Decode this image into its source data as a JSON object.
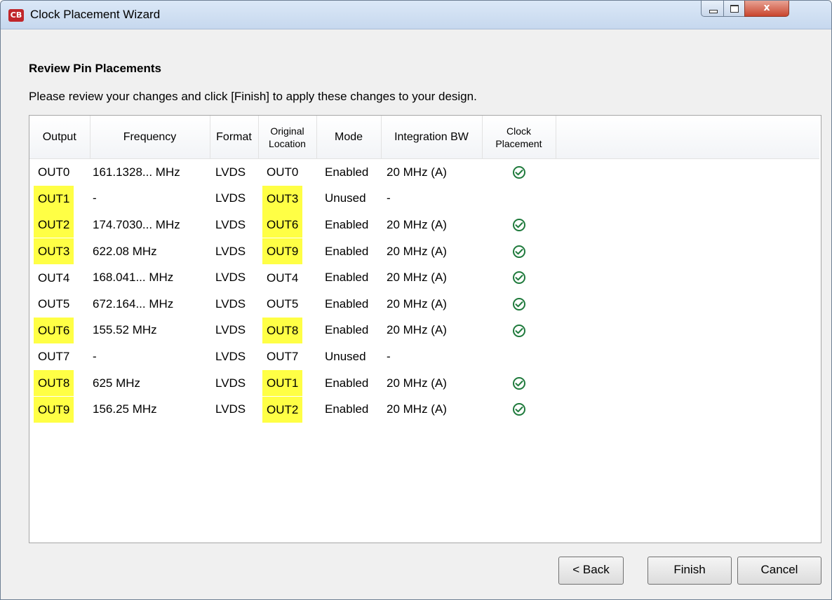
{
  "window": {
    "title": "Clock Placement Wizard",
    "app_icon_text": "CB"
  },
  "page": {
    "heading": "Review Pin Placements",
    "instructions": "Please review your changes and click [Finish] to apply these changes to your design."
  },
  "table": {
    "columns": [
      {
        "key": "output",
        "label": "Output"
      },
      {
        "key": "frequency",
        "label": "Frequency"
      },
      {
        "key": "format",
        "label": "Format"
      },
      {
        "key": "original_location",
        "label_line1": "Original",
        "label_line2": "Location"
      },
      {
        "key": "mode",
        "label": "Mode"
      },
      {
        "key": "integration_bw",
        "label": "Integration BW"
      },
      {
        "key": "clock_placement",
        "label_line1": "Clock",
        "label_line2": "Placement"
      }
    ],
    "rows": [
      {
        "output": "OUT0",
        "frequency": "161.1328... MHz",
        "format": "LVDS",
        "original_location": "OUT0",
        "mode": "Enabled",
        "integration_bw": "20 MHz (A)",
        "placed": true,
        "highlight": false
      },
      {
        "output": "OUT1",
        "frequency": "-",
        "format": "LVDS",
        "original_location": "OUT3",
        "mode": "Unused",
        "integration_bw": "-",
        "placed": false,
        "highlight": true
      },
      {
        "output": "OUT2",
        "frequency": "174.7030... MHz",
        "format": "LVDS",
        "original_location": "OUT6",
        "mode": "Enabled",
        "integration_bw": "20 MHz (A)",
        "placed": true,
        "highlight": true
      },
      {
        "output": "OUT3",
        "frequency": "622.08 MHz",
        "format": "LVDS",
        "original_location": "OUT9",
        "mode": "Enabled",
        "integration_bw": "20 MHz (A)",
        "placed": true,
        "highlight": true
      },
      {
        "output": "OUT4",
        "frequency": "168.041... MHz",
        "format": "LVDS",
        "original_location": "OUT4",
        "mode": "Enabled",
        "integration_bw": "20 MHz (A)",
        "placed": true,
        "highlight": false
      },
      {
        "output": "OUT5",
        "frequency": "672.164... MHz",
        "format": "LVDS",
        "original_location": "OUT5",
        "mode": "Enabled",
        "integration_bw": "20 MHz (A)",
        "placed": true,
        "highlight": false
      },
      {
        "output": "OUT6",
        "frequency": "155.52 MHz",
        "format": "LVDS",
        "original_location": "OUT8",
        "mode": "Enabled",
        "integration_bw": "20 MHz (A)",
        "placed": true,
        "highlight": true
      },
      {
        "output": "OUT7",
        "frequency": "-",
        "format": "LVDS",
        "original_location": "OUT7",
        "mode": "Unused",
        "integration_bw": "-",
        "placed": false,
        "highlight": false
      },
      {
        "output": "OUT8",
        "frequency": "625 MHz",
        "format": "LVDS",
        "original_location": "OUT1",
        "mode": "Enabled",
        "integration_bw": "20 MHz (A)",
        "placed": true,
        "highlight": true
      },
      {
        "output": "OUT9",
        "frequency": "156.25 MHz",
        "format": "LVDS",
        "original_location": "OUT2",
        "mode": "Enabled",
        "integration_bw": "20 MHz (A)",
        "placed": true,
        "highlight": true
      }
    ]
  },
  "buttons": {
    "back": "< Back",
    "finish": "Finish",
    "cancel": "Cancel"
  },
  "colors": {
    "highlight": "#ffff45",
    "check": "#1f7a3c",
    "title_bar": "#c6d8ee"
  },
  "icons": {
    "check": "check-circle-icon",
    "minimize": "minimize-icon",
    "maximize": "maximize-icon",
    "close": "close-icon"
  }
}
